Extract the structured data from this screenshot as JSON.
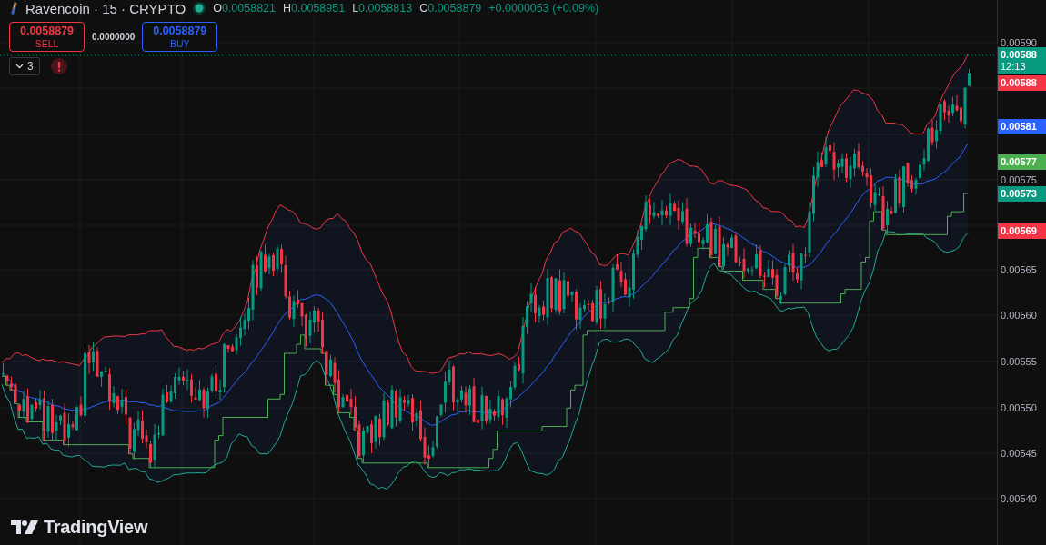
{
  "header": {
    "symbol": "Ravencoin · 15 · CRYPTO",
    "ohlc": [
      {
        "label": "O",
        "value": "0.0058821"
      },
      {
        "label": "H",
        "value": "0.0058951"
      },
      {
        "label": "L",
        "value": "0.0058813"
      },
      {
        "label": "C",
        "value": "0.0058879"
      }
    ],
    "change": "+0.0000053 (+0.09%)"
  },
  "trade": {
    "sell": {
      "price": "0.0058879",
      "label": "SELL"
    },
    "spread": "0.0000000",
    "buy": {
      "price": "0.0058879",
      "label": "BUY"
    }
  },
  "indicators": {
    "count": "3"
  },
  "price_axis": {
    "ticks": [
      "0.00590",
      "0.00575",
      "0.00565",
      "0.00560",
      "0.00555",
      "0.00550",
      "0.00545",
      "0.00540"
    ]
  },
  "price_labels": [
    {
      "text": "0.00588",
      "countdown": "12:13",
      "color": "#089981"
    },
    {
      "text": "0.00588",
      "color": "#f23645"
    },
    {
      "text": "0.00581",
      "color": "#2962ff"
    },
    {
      "text": "0.00577",
      "color": "#4caf50"
    },
    {
      "text": "0.00573",
      "color": "#089981"
    },
    {
      "text": "0.00569",
      "color": "#f23645"
    }
  ],
  "branding": {
    "logo_text": "TradingView"
  }
}
